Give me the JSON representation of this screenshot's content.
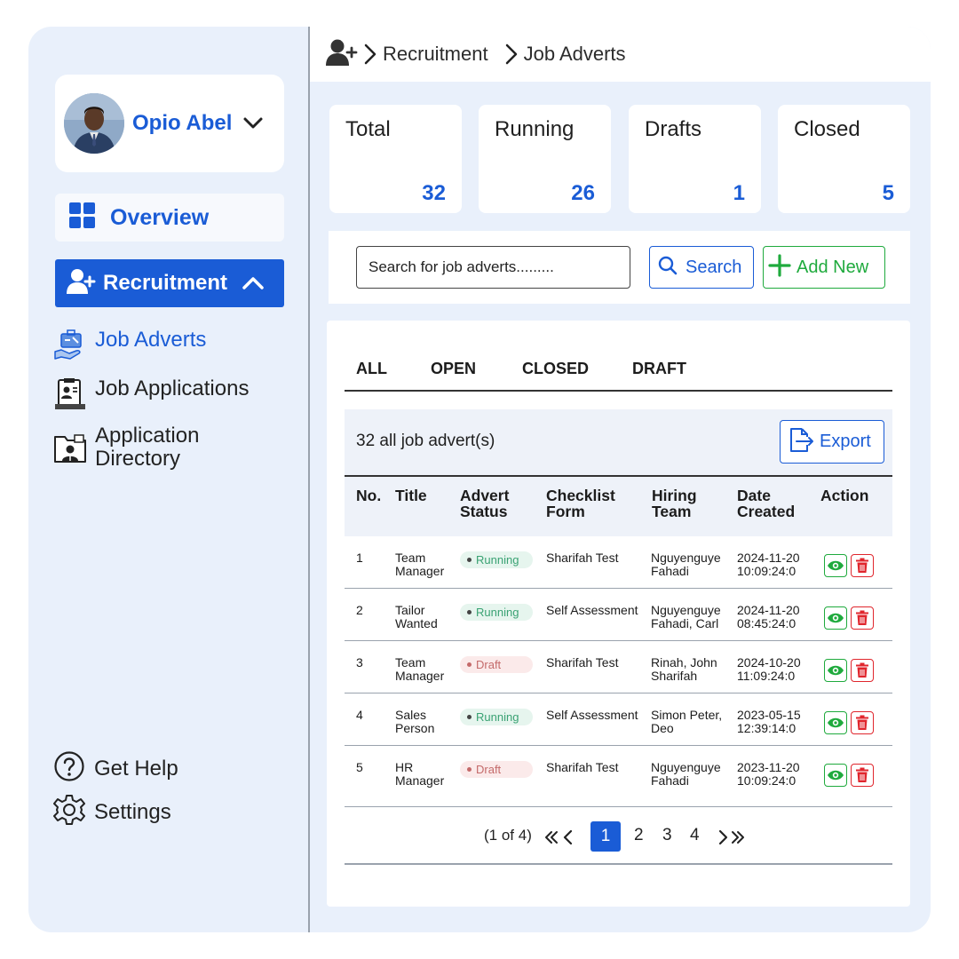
{
  "profile": {
    "name": "Opio Abel"
  },
  "nav": {
    "overview": "Overview",
    "recruitment": "Recruitment",
    "sub_items": [
      "Job Adverts",
      "Job Applications",
      "Application Directory"
    ],
    "help": "Get Help",
    "settings": "Settings"
  },
  "breadcrumb": [
    "Recruitment",
    "Job Adverts"
  ],
  "stats": [
    {
      "label": "Total",
      "value": "32"
    },
    {
      "label": "Running",
      "value": "26"
    },
    {
      "label": "Drafts",
      "value": "1"
    },
    {
      "label": "Closed",
      "value": "5"
    }
  ],
  "search": {
    "placeholder": "Search for job adverts.........",
    "button": "Search",
    "add_new": "Add New"
  },
  "filter_tabs": [
    "ALL",
    "OPEN",
    "CLOSED",
    "DRAFT"
  ],
  "table": {
    "count_text": "32 all job advert(s)",
    "export": "Export",
    "columns": [
      "No.",
      "Title",
      "Advert Status",
      "Checklist Form",
      "Hiring Team",
      "Date Created",
      "Action"
    ],
    "rows": [
      {
        "no": "1",
        "title": "Team Manager",
        "status": "Running",
        "form": "Sharifah Test",
        "team": "Nguyenguye Fahadi",
        "date": "2024-11-20 10:09:24:0"
      },
      {
        "no": "2",
        "title": "Tailor Wanted",
        "status": "Running",
        "form": "Self Assessment",
        "team": "Nguyenguye Fahadi, Carl",
        "date": "2024-11-20 08:45:24:0"
      },
      {
        "no": "3",
        "title": "Team Manager",
        "status": "Draft",
        "form": "Sharifah Test",
        "team": "Rinah, John Sharifah",
        "date": "2024-10-20 11:09:24:0"
      },
      {
        "no": "4",
        "title": "Sales Person",
        "status": "Running",
        "form": "Self Assessment",
        "team": "Simon Peter, Deo",
        "date": "2023-05-15 12:39:14:0"
      },
      {
        "no": "5",
        "title": "HR Manager",
        "status": "Draft",
        "form": "Sharifah Test",
        "team": "Nguyenguye Fahadi",
        "date": "2023-11-20 10:09:24:0"
      }
    ]
  },
  "pagination": {
    "info": "(1 of 4)",
    "pages": [
      "1",
      "2",
      "3",
      "4"
    ],
    "current": "1"
  },
  "colors": {
    "brand": "#1a5cd6",
    "success": "#1faa3d",
    "danger": "#e0262d",
    "background": "#e9f0fb"
  }
}
